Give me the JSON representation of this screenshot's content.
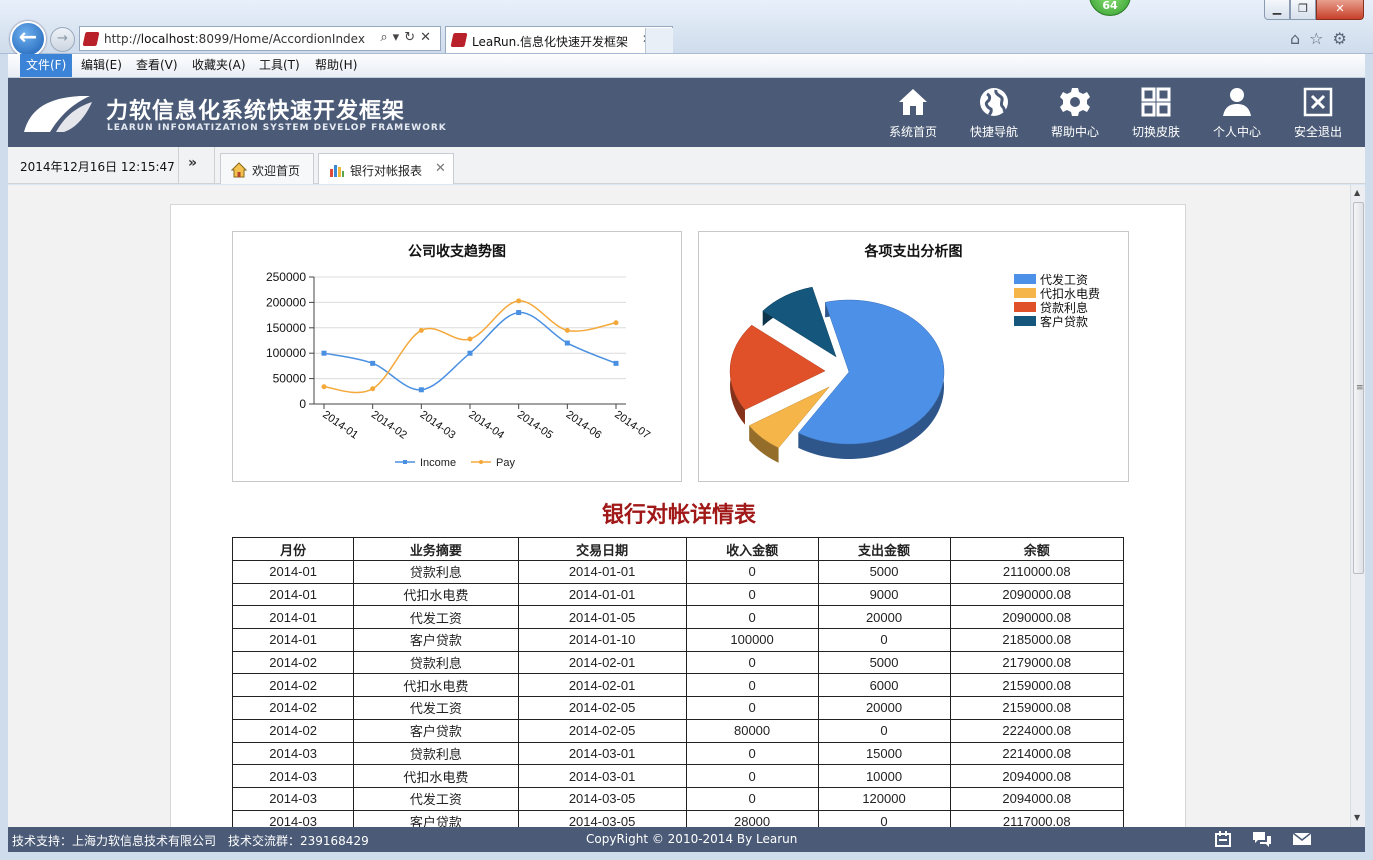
{
  "browser": {
    "url_prefix": "http://",
    "url_host": "localhost",
    "url_rest": ":8099/Home/AccordionIndex",
    "tab_title": "LeaRun.信息化快速开发框架",
    "badge": "64"
  },
  "menu": [
    "文件(F)",
    "编辑(E)",
    "查看(V)",
    "收藏夹(A)",
    "工具(T)",
    "帮助(H)"
  ],
  "header": {
    "title": "力软信息化系统快速开发框架",
    "subtitle": "LEARUN INFOMATIZATION SYSTEM DEVELOP FRAMEWORK",
    "nav": [
      "系统首页",
      "快捷导航",
      "帮助中心",
      "切换皮肤",
      "个人中心",
      "安全退出"
    ]
  },
  "tabsbar": {
    "datetime": "2014年12月16日 12:15:47",
    "more": "»",
    "tabs": [
      "欢迎首页",
      "银行对帐报表"
    ]
  },
  "line_chart": {
    "title": "公司收支趋势图",
    "legend": [
      "Income",
      "Pay"
    ]
  },
  "pie_chart": {
    "title": "各项支出分析图",
    "legend": [
      "代发工资",
      "代扣水电费",
      "贷款利息",
      "客户贷款"
    ]
  },
  "chart_data": [
    {
      "type": "line",
      "title": "公司收支趋势图",
      "x": [
        "2014-01",
        "2014-02",
        "2014-03",
        "2014-04",
        "2014-05",
        "2014-06",
        "2014-07"
      ],
      "ylim": [
        0,
        250000
      ],
      "yticks": [
        "250000",
        "200000",
        "150000",
        "100000",
        "50000",
        "0"
      ],
      "legend_position": "bottom",
      "series": [
        {
          "name": "Income",
          "color": "#4a90e2",
          "values": [
            100000,
            80000,
            28000,
            100000,
            180000,
            120000,
            80000
          ]
        },
        {
          "name": "Pay",
          "color": "#f5a83a",
          "values": [
            34000,
            30000,
            145000,
            128000,
            203000,
            145000,
            160000
          ]
        }
      ]
    },
    {
      "type": "pie",
      "title": "各项支出分析图",
      "legend_position": "top-right",
      "slices": [
        {
          "name": "代发工资",
          "value": 63,
          "color": "#4d90e8"
        },
        {
          "name": "代扣水电费",
          "value": 7,
          "color": "#f6b548"
        },
        {
          "name": "贷款利息",
          "value": 20,
          "color": "#e0512a"
        },
        {
          "name": "客户贷款",
          "value": 10,
          "color": "#14567c"
        }
      ]
    }
  ],
  "table": {
    "title": "银行对帐详情表",
    "headers": [
      "月份",
      "业务摘要",
      "交易日期",
      "收入金额",
      "支出金额",
      "余额"
    ],
    "rows": [
      [
        "2014-01",
        "贷款利息",
        "2014-01-01",
        "0",
        "5000",
        "2110000.08"
      ],
      [
        "2014-01",
        "代扣水电费",
        "2014-01-01",
        "0",
        "9000",
        "2090000.08"
      ],
      [
        "2014-01",
        "代发工资",
        "2014-01-05",
        "0",
        "20000",
        "2090000.08"
      ],
      [
        "2014-01",
        "客户贷款",
        "2014-01-10",
        "100000",
        "0",
        "2185000.08"
      ],
      [
        "2014-02",
        "贷款利息",
        "2014-02-01",
        "0",
        "5000",
        "2179000.08"
      ],
      [
        "2014-02",
        "代扣水电费",
        "2014-02-01",
        "0",
        "6000",
        "2159000.08"
      ],
      [
        "2014-02",
        "代发工资",
        "2014-02-05",
        "0",
        "20000",
        "2159000.08"
      ],
      [
        "2014-02",
        "客户贷款",
        "2014-02-05",
        "80000",
        "0",
        "2224000.08"
      ],
      [
        "2014-03",
        "贷款利息",
        "2014-03-01",
        "0",
        "15000",
        "2214000.08"
      ],
      [
        "2014-03",
        "代扣水电费",
        "2014-03-01",
        "0",
        "10000",
        "2094000.08"
      ],
      [
        "2014-03",
        "代发工资",
        "2014-03-05",
        "0",
        "120000",
        "2094000.08"
      ],
      [
        "2014-03",
        "客户贷款",
        "2014-03-05",
        "28000",
        "0",
        "2117000.08"
      ]
    ]
  },
  "footer": {
    "left": "技术支持：上海力软信息技术有限公司　技术交流群：239168429",
    "center": "CopyRight © 2010-2014 By Learun"
  }
}
